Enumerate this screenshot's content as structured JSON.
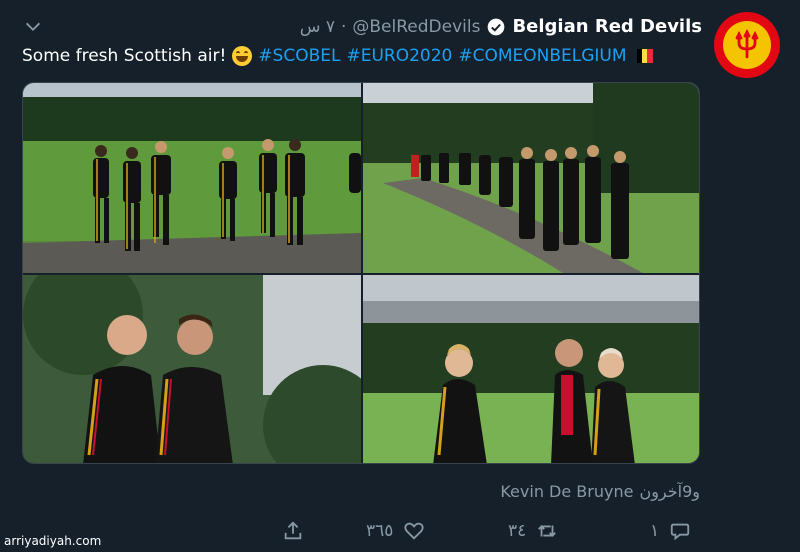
{
  "tweet": {
    "display_name": "Belgian Red Devils",
    "handle": "@BelRedDevils",
    "separator": "·",
    "time": "٧ س",
    "text_plain": "Some fresh Scottish air!",
    "hashtags": [
      "#SCOBEL",
      "#EURO2020",
      "#COMEONBELGIUM"
    ],
    "tagged_name": "Kevin De Bruyne",
    "tagged_others": "و9آخرون"
  },
  "actions": {
    "reply_count": "١",
    "retweet_count": "٣٤",
    "like_count": "٣٦٥"
  },
  "watermark": "arriyadiyah.com",
  "colors": {
    "background": "#15202b",
    "link": "#1da1f2",
    "muted": "#8899a6",
    "avatar_red": "#e30613",
    "avatar_yellow": "#f5c400"
  },
  "icons": [
    "chevron-down-icon",
    "verified-badge-icon",
    "smile-emoji-icon",
    "belgium-flag-icon",
    "reply-icon",
    "retweet-icon",
    "like-icon",
    "share-icon"
  ]
}
